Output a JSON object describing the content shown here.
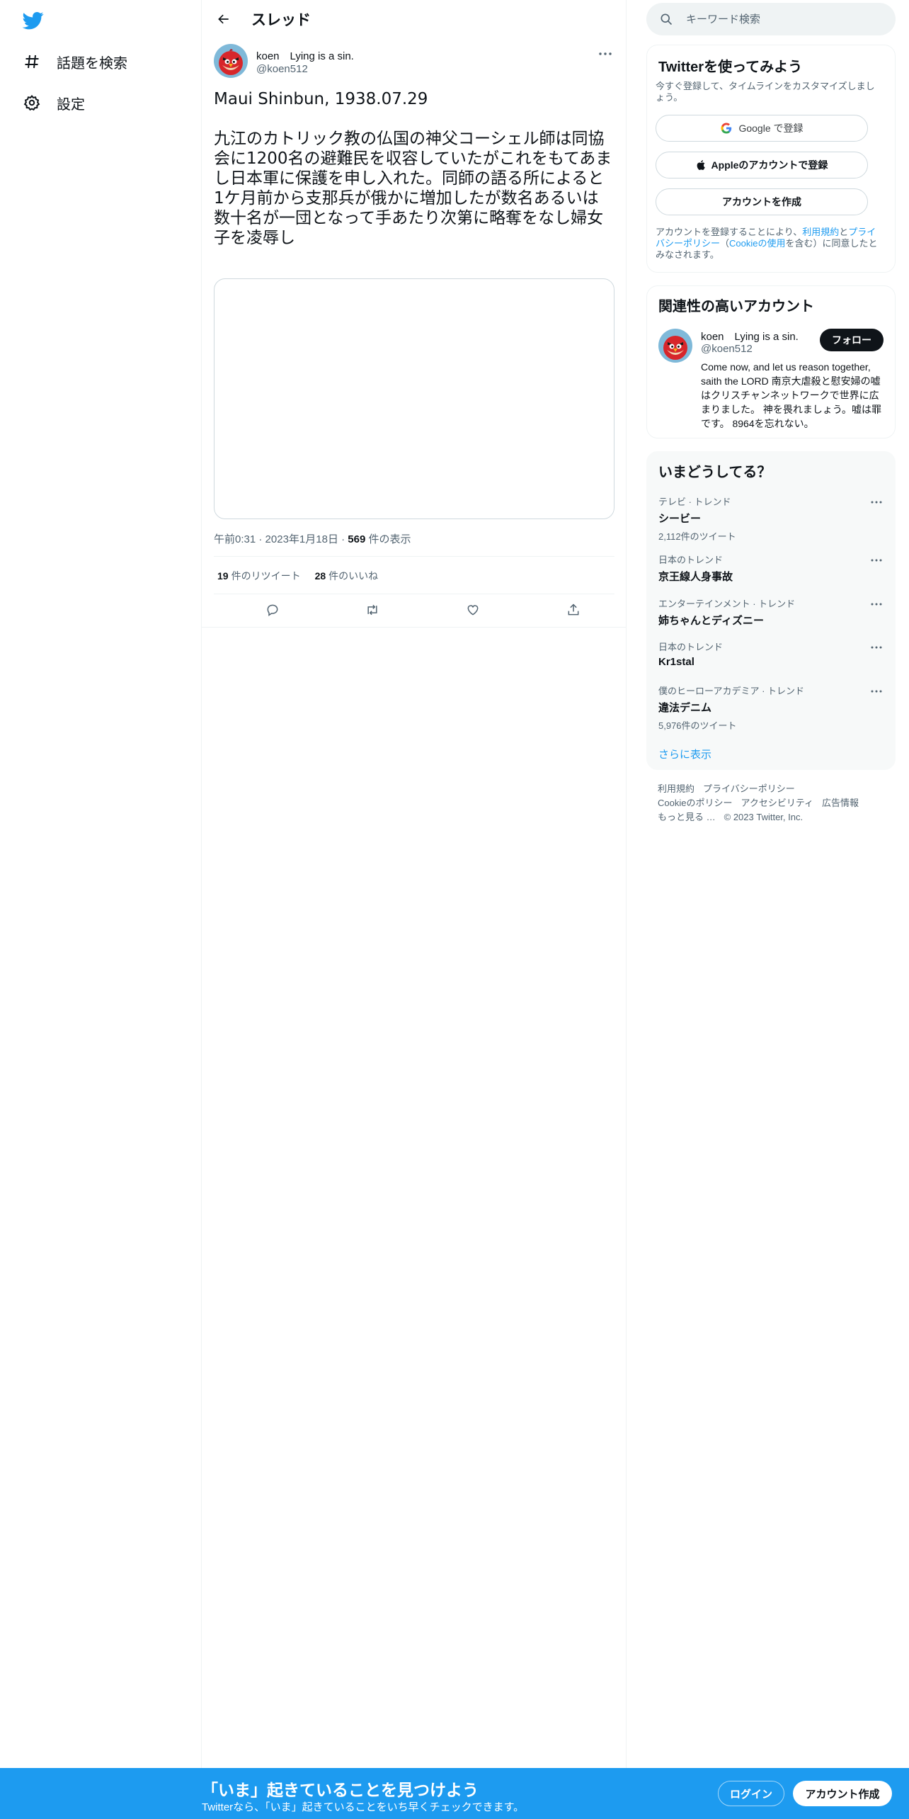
{
  "nav": {
    "logo_icon": "twitter-bird-icon",
    "items": [
      {
        "label": "話題を検索",
        "icon": "hashtag-icon"
      },
      {
        "label": "設定",
        "icon": "gear-icon"
      }
    ]
  },
  "header": {
    "title": "スレッド"
  },
  "tweet": {
    "author_name": "koen　Lying is a sin.",
    "author_handle": "@koen512",
    "text": "Maui Shinbun, 1938.07.29\n\n九江のカトリック教の仏国の神父コーシェル師は同協会に1200名の避難民を収容していたがこれをもてあまし日本軍に保護を申し入れた。同師の語る所によると\n1ケ月前から支那兵が俄かに増加したが数名あるいは数十名が一団となって手あたり次第に略奪をなし婦女子を凌辱し",
    "time": "午前0:31",
    "date": "2023年1月18日",
    "views_count": "569",
    "views_label": "件の表示",
    "retweets_count": "19",
    "retweets_label": "件のリツイート",
    "likes_count": "28",
    "likes_label": "件のいいね"
  },
  "search": {
    "placeholder": "キーワード検索"
  },
  "signup": {
    "title": "Twitterを使ってみよう",
    "subtitle": "今すぐ登録して、タイムラインをカスタマイズしましょう。",
    "google_label": "Google で登録",
    "apple_label": "Appleのアカウントで登録",
    "create_label": "アカウントを作成",
    "terms_pre": "アカウントを登録することにより、",
    "terms_link1": "利用規約",
    "terms_mid1": "と",
    "terms_link2": "プライバシーポリシー",
    "terms_mid2": "（",
    "terms_link3": "Cookieの使用",
    "terms_post": "を含む）に同意したとみなされます。"
  },
  "related": {
    "title": "関連性の高いアカウント",
    "name": "koen　Lying is a sin.",
    "handle": "@koen512",
    "follow_label": "フォロー",
    "bio": "Come now, and let us reason together, saith the LORD 南京大虐殺と慰安婦の嘘はクリスチャンネットワークで世界に広まりました。 神を畏れましょう。嘘は罪です。 8964を忘れない。"
  },
  "trends": {
    "title": "いまどうしてる？",
    "items": [
      {
        "context": "テレビ · トレンド",
        "name": "シービー",
        "count": "2,112件のツイート"
      },
      {
        "context": "日本のトレンド",
        "name": "京王線人身事故",
        "count": ""
      },
      {
        "context": "エンターテインメント · トレンド",
        "name": "姉ちゃんとディズニー",
        "count": ""
      },
      {
        "context": "日本のトレンド",
        "name": "Kr1stal",
        "count": ""
      },
      {
        "context": "僕のヒーローアカデミア · トレンド",
        "name": "違法デニム",
        "count": "5,976件のツイート"
      }
    ],
    "show_more": "さらに表示"
  },
  "footer": {
    "links": [
      "利用規約",
      "プライバシーポリシー",
      "Cookieのポリシー",
      "アクセシビリティ",
      "広告情報",
      "もっと見る …"
    ],
    "copyright": "© 2023 Twitter, Inc."
  },
  "bottom_bar": {
    "title": "「いま」起きていることを見つけよう",
    "subtitle": "Twitterなら、「いま」起きていることをいち早くチェックできます。",
    "login_label": "ログイン",
    "signup_label": "アカウント作成"
  },
  "colors": {
    "accent": "#1d9bf0",
    "text": "#0f1419",
    "secondary": "#536471",
    "border": "#eff3f4"
  }
}
